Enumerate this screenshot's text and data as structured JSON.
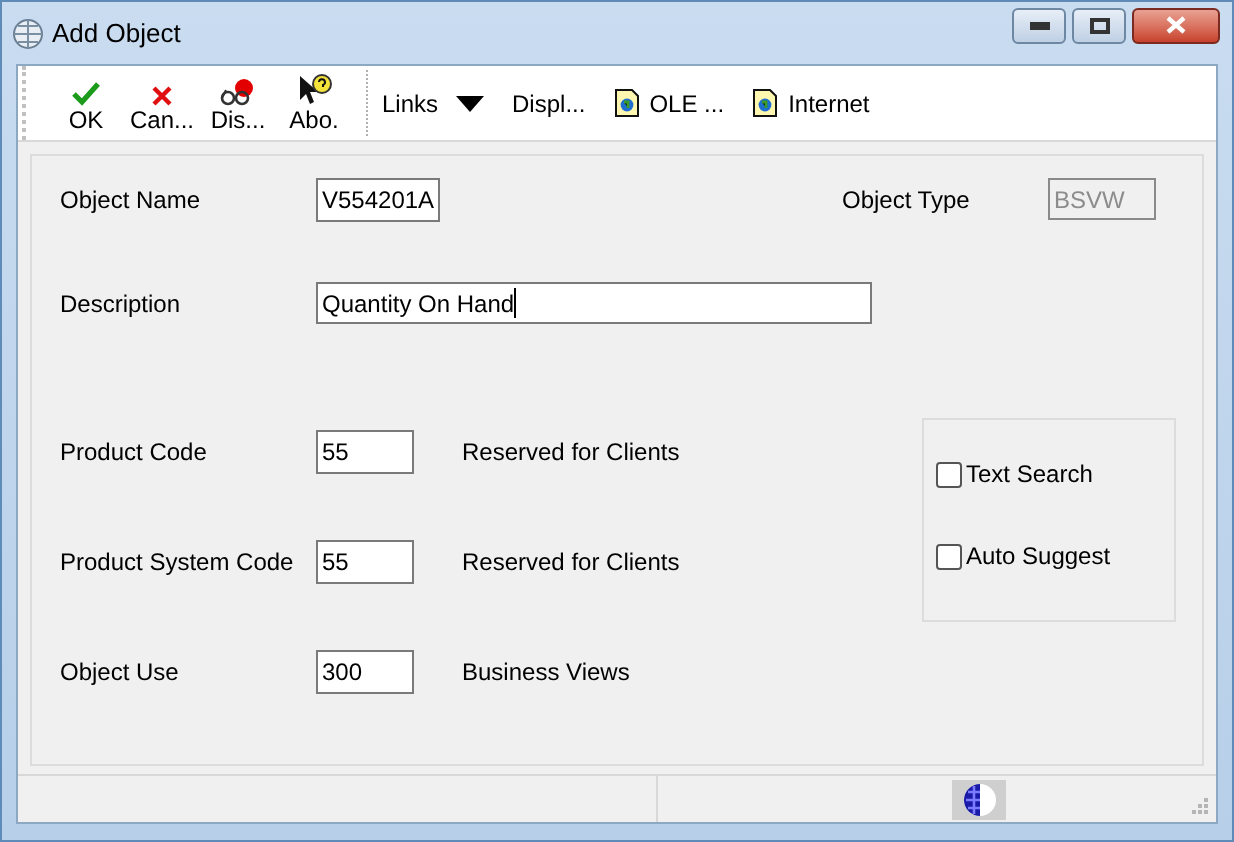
{
  "window": {
    "title": "Add Object"
  },
  "toolbar": {
    "buttons": [
      {
        "label": "OK",
        "kind": "ok"
      },
      {
        "label": "Can...",
        "kind": "cancel"
      },
      {
        "label": "Dis...",
        "kind": "display"
      },
      {
        "label": "Abo.",
        "kind": "about"
      }
    ],
    "links": [
      {
        "label": "Links",
        "kind": "dropdown"
      },
      {
        "label": "Displ...",
        "kind": "plain"
      },
      {
        "label": "OLE ...",
        "kind": "document"
      },
      {
        "label": "Internet",
        "kind": "document"
      }
    ]
  },
  "object_name": {
    "label": "Object Name",
    "value": "V554201A"
  },
  "object_type": {
    "label": "Object Type",
    "value": "BSVW",
    "disabled": true
  },
  "description": {
    "label": "Description",
    "value": "Quantity On Hand"
  },
  "codes": [
    {
      "label": "Product Code",
      "value": "55",
      "note": "Reserved for Clients"
    },
    {
      "label": "Product System Code",
      "value": "55",
      "note": "Reserved for Clients"
    },
    {
      "label": "Object Use",
      "value": "300",
      "note": "Business Views"
    }
  ],
  "options": [
    {
      "label": "Text Search",
      "checked": false
    },
    {
      "label": "Auto Suggest",
      "checked": false
    }
  ]
}
